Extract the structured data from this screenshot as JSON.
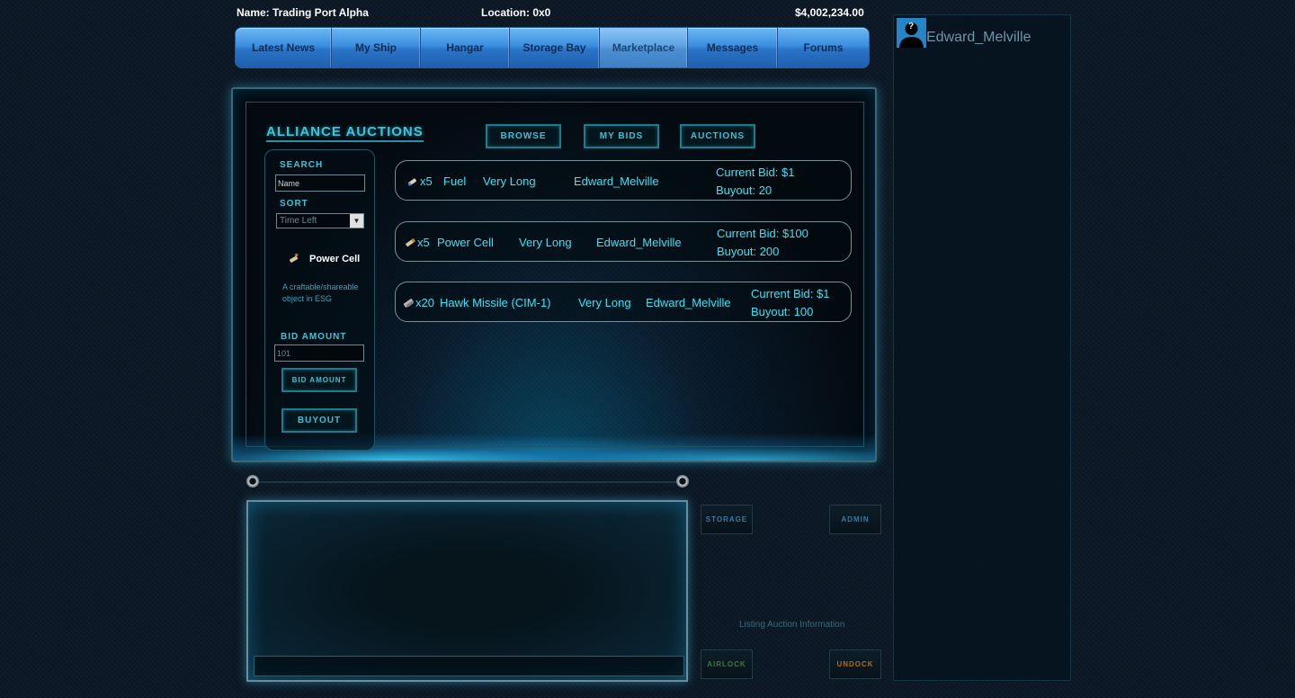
{
  "header": {
    "name": "Name: Trading Port Alpha",
    "location": "Location: 0x0",
    "credits": "$4,002,234.00"
  },
  "nav": {
    "items": [
      {
        "label": "Latest News"
      },
      {
        "label": "My Ship"
      },
      {
        "label": "Hangar"
      },
      {
        "label": "Storage Bay"
      },
      {
        "label": "Marketplace"
      },
      {
        "label": "Messages"
      },
      {
        "label": "Forums"
      }
    ],
    "active": "Marketplace"
  },
  "user": {
    "name": "Edward_Melville",
    "avatar_icon": "unknown-user-icon",
    "avatar_mark": "?"
  },
  "auction": {
    "title": "Alliance Auctions",
    "tabs": {
      "browse": "Browse",
      "my_bids": "My Bids",
      "auctions": "Auctions"
    },
    "search_label": "Search",
    "search_value": "Name",
    "sort_label": "Sort",
    "sort_value": "Time Left",
    "selected_item": {
      "icon": "power-cell-icon",
      "name": "Power Cell",
      "description": "A craftable/shareable object in ESG"
    },
    "bid_label": "Bid Amount",
    "bid_value": "101",
    "bid_button": "Bid Amount",
    "buyout_button": "Buyout",
    "rows": [
      {
        "icon": "fuel-icon",
        "quantity": "x5",
        "item": "Fuel",
        "time": "Very Long",
        "seller": "Edward_Melville",
        "current_bid": "Current Bid: $1",
        "buyout": "Buyout: 20"
      },
      {
        "icon": "power-cell-icon",
        "quantity": "x5",
        "item": "Power Cell",
        "time": "Very Long",
        "seller": "Edward_Melville",
        "current_bid": "Current Bid: $100",
        "buyout": "Buyout: 200"
      },
      {
        "icon": "missile-icon",
        "quantity": "x20",
        "item": "Hawk Missile (CIM-1)",
        "time": "Very Long",
        "seller": "Edward_Melville",
        "current_bid": "Current Bid: $1",
        "buyout": "Buyout: 100"
      }
    ]
  },
  "pads": {
    "storage": "Storage",
    "admin": "Admin",
    "airlock": "Airlock",
    "undock": "Undock"
  },
  "listing_info": "Listing Auction Information",
  "colors": {
    "accent": "#36e4f4",
    "nav_blue": "#3b8ee0",
    "background": "#0b1826"
  }
}
